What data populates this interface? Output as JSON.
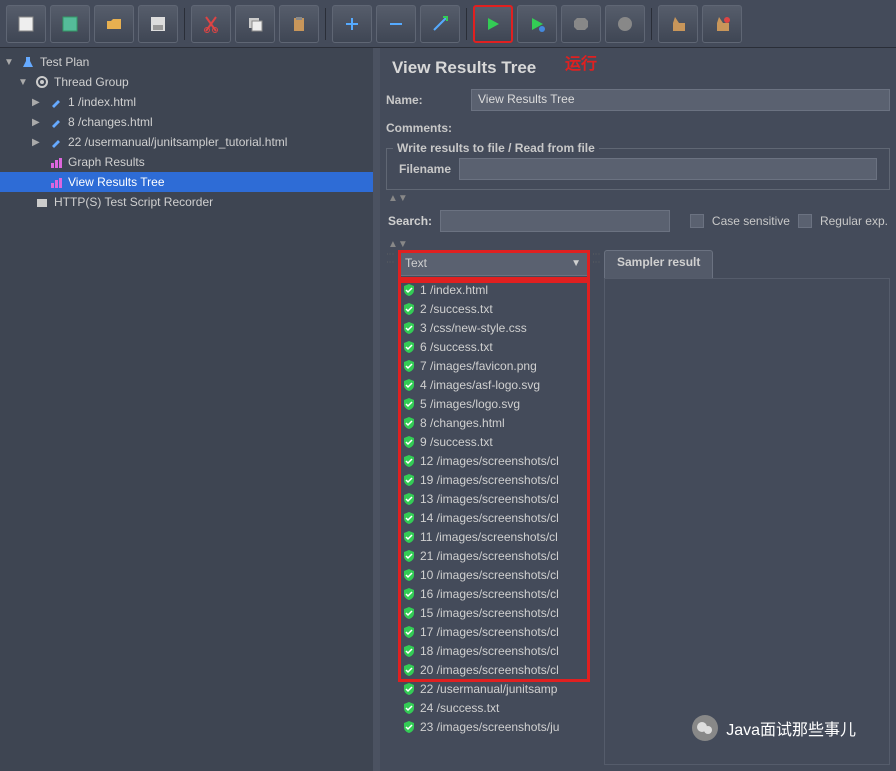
{
  "toolbar_annotation": "运行",
  "tree": {
    "root": "Test Plan",
    "thread_group": "Thread Group",
    "items": [
      {
        "label": "1 /index.html",
        "type": "http"
      },
      {
        "label": "8 /changes.html",
        "type": "http"
      },
      {
        "label": "22 /usermanual/junitsampler_tutorial.html",
        "type": "http"
      },
      {
        "label": "Graph Results",
        "type": "graph"
      },
      {
        "label": "View Results Tree",
        "type": "tree",
        "selected": true
      }
    ],
    "recorder": "HTTP(S) Test Script Recorder"
  },
  "panel": {
    "title": "View Results Tree",
    "name_label": "Name:",
    "name_value": "View Results Tree",
    "comments_label": "Comments:",
    "fieldset_legend": "Write results to file / Read from file",
    "filename_label": "Filename"
  },
  "search": {
    "label": "Search:",
    "case_sensitive": "Case sensitive",
    "regex": "Regular exp."
  },
  "results": {
    "combo_value": "Text",
    "tab_label": "Sampler result",
    "items": [
      "1 /index.html",
      "2 /success.txt",
      "3 /css/new-style.css",
      "6 /success.txt",
      "7 /images/favicon.png",
      "4 /images/asf-logo.svg",
      "5 /images/logo.svg",
      "8 /changes.html",
      "9 /success.txt",
      "12 /images/screenshots/cl",
      "19 /images/screenshots/cl",
      "13 /images/screenshots/cl",
      "14 /images/screenshots/cl",
      "11 /images/screenshots/cl",
      "21 /images/screenshots/cl",
      "10 /images/screenshots/cl",
      "16 /images/screenshots/cl",
      "15 /images/screenshots/cl",
      "17 /images/screenshots/cl",
      "18 /images/screenshots/cl",
      "20 /images/screenshots/cl",
      "22 /usermanual/junitsamp",
      "24 /success.txt",
      "23 /images/screenshots/ju"
    ]
  },
  "watermark": "Java面试那些事儿"
}
